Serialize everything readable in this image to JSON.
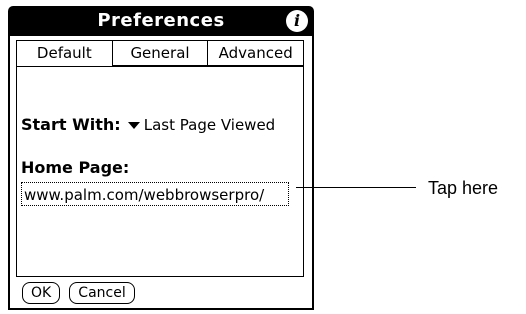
{
  "window": {
    "title": "Preferences",
    "info_icon": "info-icon"
  },
  "tabs": [
    {
      "label": "Default",
      "active": true
    },
    {
      "label": "General",
      "active": false
    },
    {
      "label": "Advanced",
      "active": false
    }
  ],
  "start_with": {
    "label": "Start With:",
    "selected": "Last Page Viewed"
  },
  "home_page": {
    "label": "Home Page:",
    "value": "www.palm.com/webbrowserpro/"
  },
  "buttons": {
    "ok": "OK",
    "cancel": "Cancel"
  },
  "callout": {
    "text": "Tap here"
  }
}
